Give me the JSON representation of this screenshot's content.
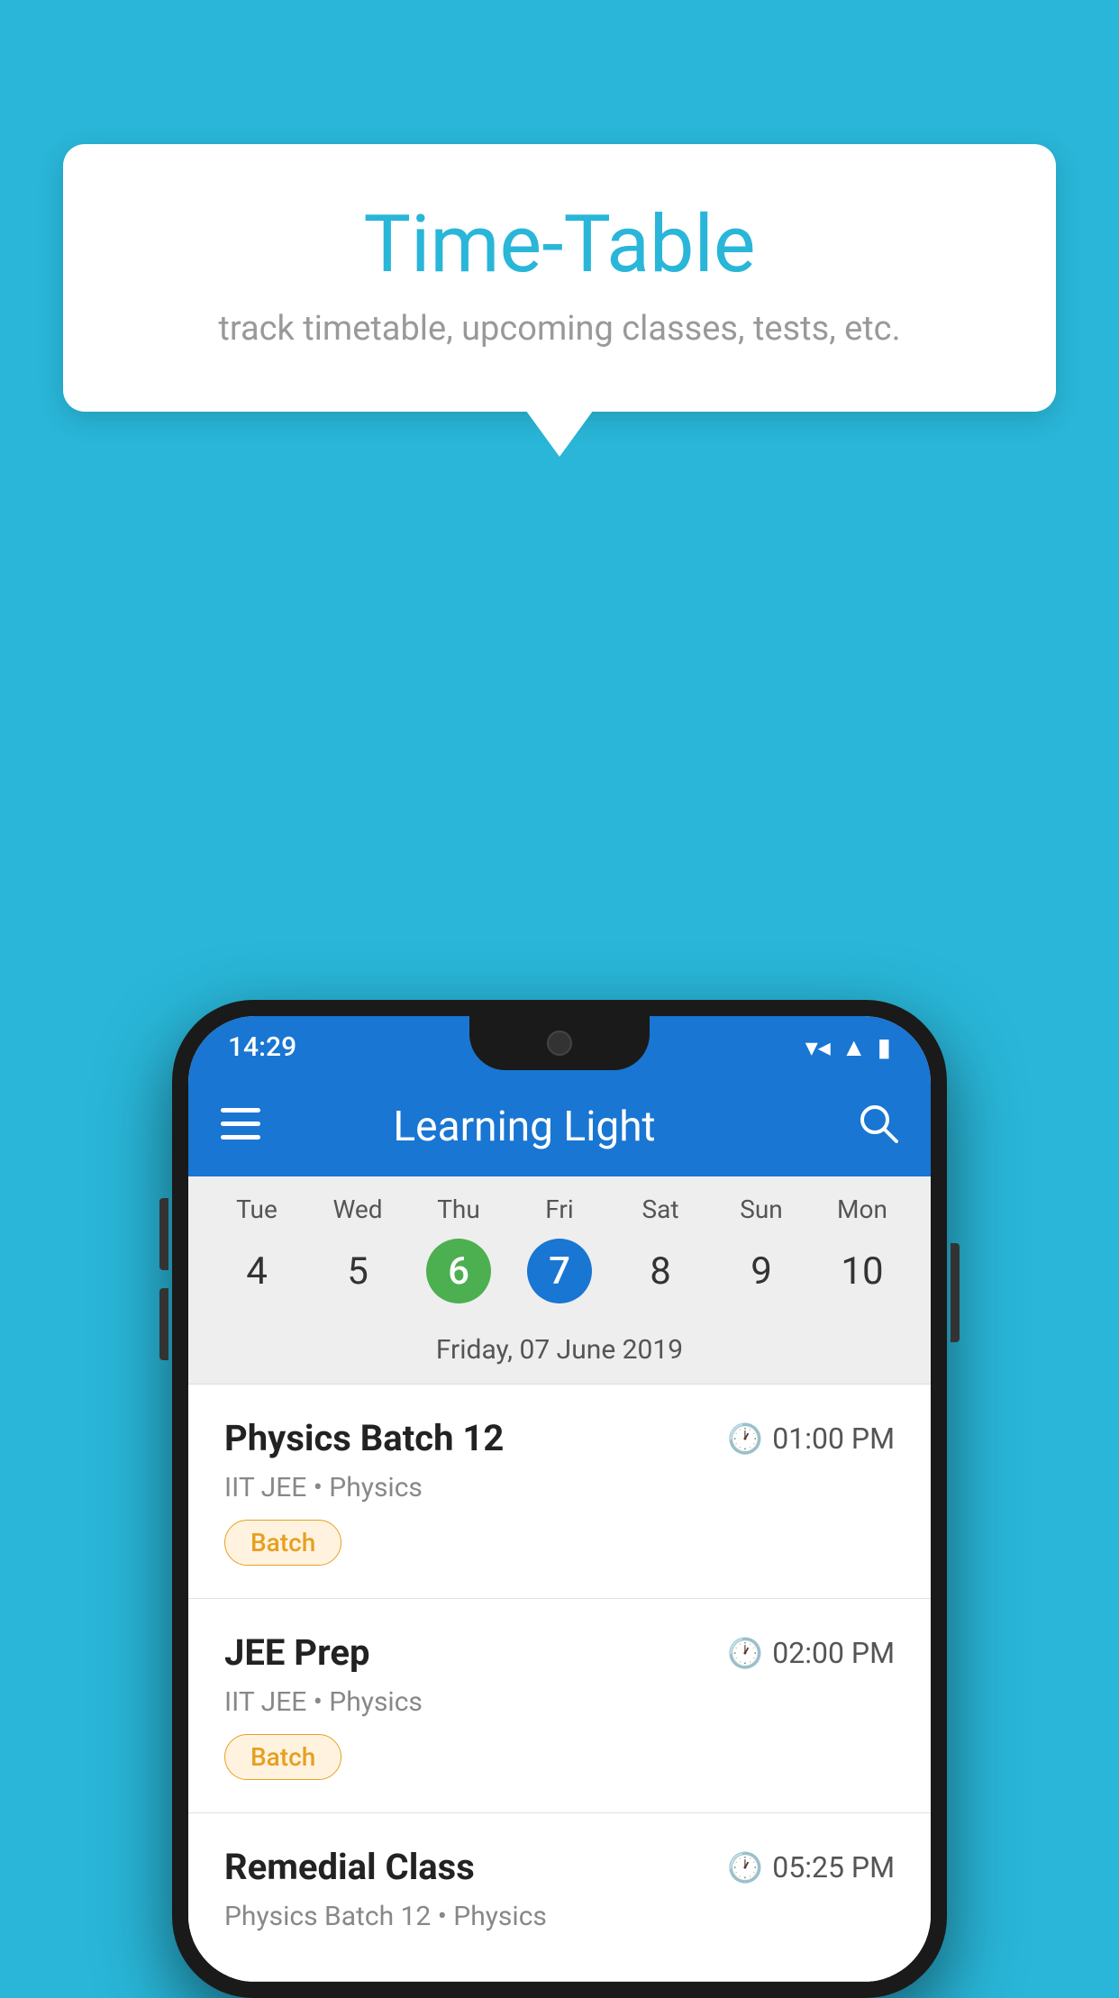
{
  "background": {
    "color": "#29B6D8"
  },
  "tooltip": {
    "title": "Time-Table",
    "subtitle": "track timetable, upcoming classes, tests, etc."
  },
  "phone": {
    "status_bar": {
      "time": "14:29"
    },
    "app_bar": {
      "title": "Learning Light"
    },
    "calendar": {
      "days": [
        {
          "name": "Tue",
          "num": "4",
          "state": "normal"
        },
        {
          "name": "Wed",
          "num": "5",
          "state": "normal"
        },
        {
          "name": "Thu",
          "num": "6",
          "state": "today"
        },
        {
          "name": "Fri",
          "num": "7",
          "state": "selected"
        },
        {
          "name": "Sat",
          "num": "8",
          "state": "normal"
        },
        {
          "name": "Sun",
          "num": "9",
          "state": "normal"
        },
        {
          "name": "Mon",
          "num": "10",
          "state": "normal"
        }
      ],
      "selected_date_label": "Friday, 07 June 2019"
    },
    "schedule": [
      {
        "title": "Physics Batch 12",
        "time": "01:00 PM",
        "meta": "IIT JEE • Physics",
        "badge": "Batch"
      },
      {
        "title": "JEE Prep",
        "time": "02:00 PM",
        "meta": "IIT JEE • Physics",
        "badge": "Batch"
      },
      {
        "title": "Remedial Class",
        "time": "05:25 PM",
        "meta": "Physics Batch 12 • Physics",
        "badge": null
      }
    ]
  }
}
